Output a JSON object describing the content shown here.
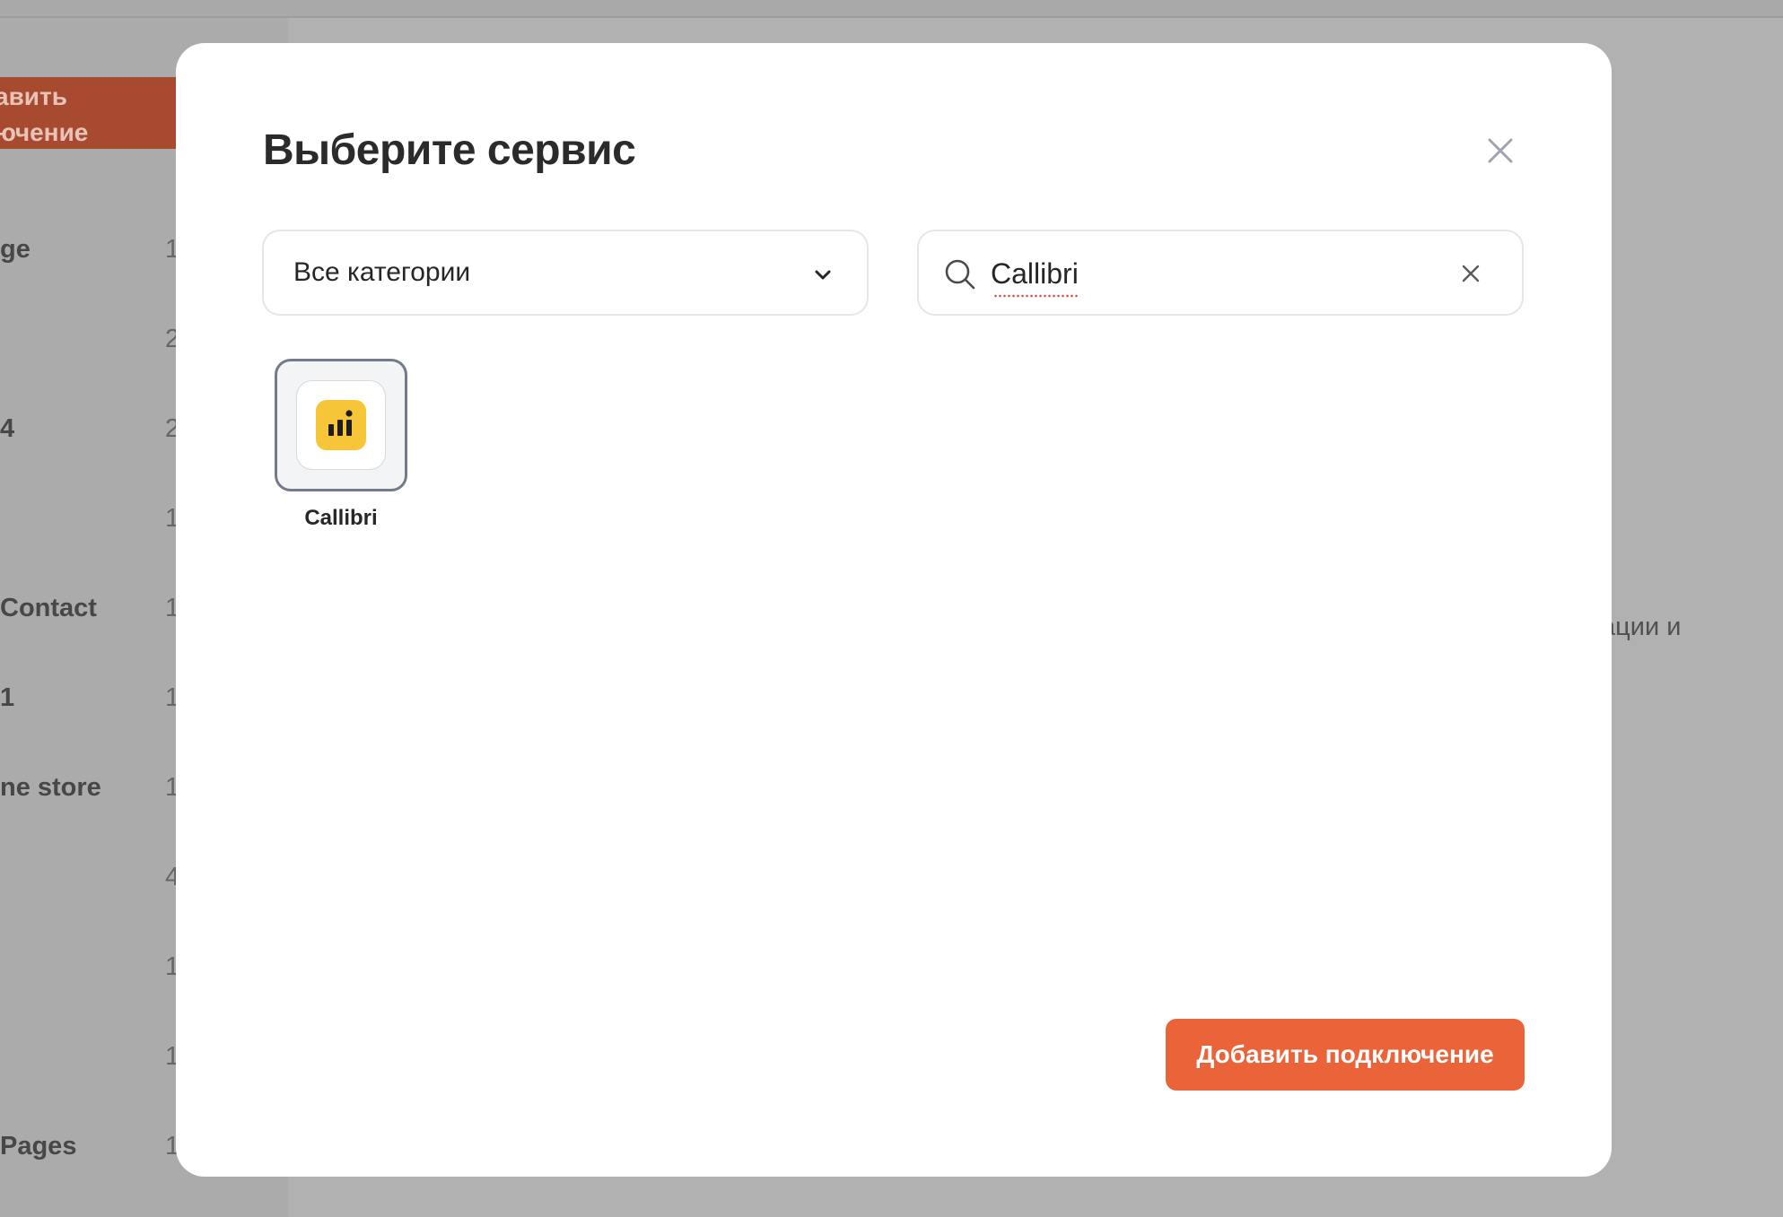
{
  "background": {
    "add_button_label_line1": "авить",
    "add_button_label_line2": "ючение",
    "sidebar_items": [
      {
        "label": "ge",
        "count": "1"
      },
      {
        "label": "",
        "count": "2"
      },
      {
        "label": "4",
        "count": "2"
      },
      {
        "label": "",
        "count": "1"
      },
      {
        "label": "Contact",
        "count": "1"
      },
      {
        "label": "1",
        "count": "1"
      },
      {
        "label": "ne store",
        "count": "1"
      },
      {
        "label": "",
        "count": "4"
      },
      {
        "label": "",
        "count": "1"
      },
      {
        "label": "",
        "count": "1"
      },
      {
        "label": "Pages",
        "count": "1"
      }
    ],
    "right_text": "ации и"
  },
  "modal": {
    "title": "Выберите сервис",
    "close_icon": "close-icon",
    "category_select": {
      "value": "Все категории",
      "icon": "chevron-down-icon"
    },
    "search": {
      "value": "Callibri",
      "icon": "search-icon",
      "clear_icon": "clear-icon"
    },
    "services": [
      {
        "name": "Callibri",
        "selected": true,
        "logo_color": "#f6c638"
      }
    ],
    "add_button_label": "Добавить подключение"
  },
  "colors": {
    "accent": "#ea6339",
    "overlay": "#b1b1b1",
    "selected_border": "#737a8a"
  }
}
